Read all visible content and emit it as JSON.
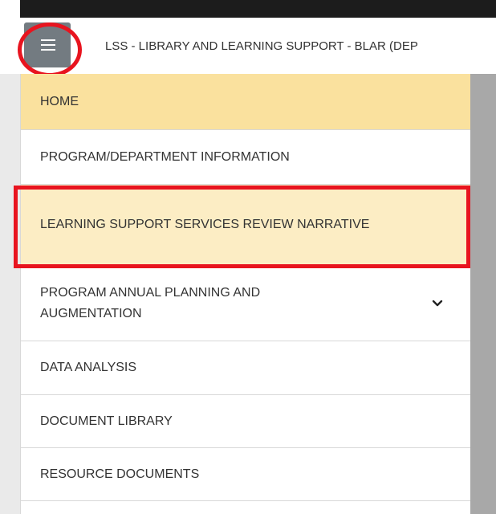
{
  "header": {
    "title": "LSS - LIBRARY AND LEARNING SUPPORT - BLAR (DEP",
    "menu_icon": "hamburger-menu-icon"
  },
  "nav": {
    "items": [
      {
        "label": "HOME",
        "state": "active"
      },
      {
        "label": "PROGRAM/DEPARTMENT INFORMATION"
      },
      {
        "label": "LEARNING SUPPORT SERVICES REVIEW NARRATIVE",
        "state": "highlighted"
      },
      {
        "label": "PROGRAM ANNUAL PLANNING AND AUGMENTATION",
        "icon": "chevron-down-icon"
      },
      {
        "label": "DATA ANALYSIS"
      },
      {
        "label": "DOCUMENT LIBRARY"
      },
      {
        "label": "RESOURCE DOCUMENTS"
      }
    ]
  },
  "colors": {
    "annotation": "#e8141f",
    "active_item": "#fae19e",
    "highlighted_item": "#fcedc4",
    "menu_button": "#737b81"
  }
}
